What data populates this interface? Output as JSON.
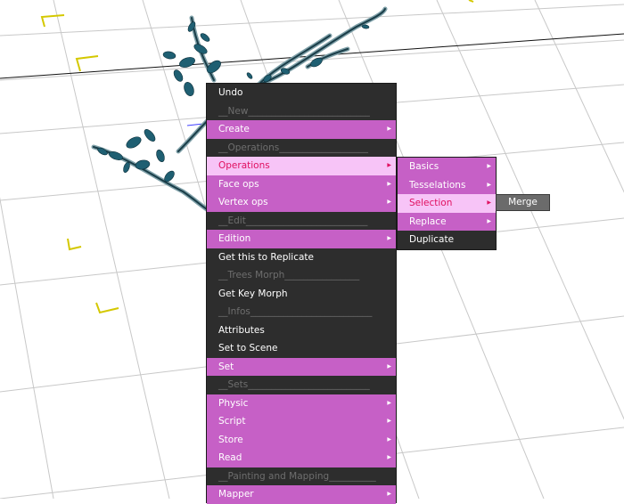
{
  "main_menu": {
    "items": [
      {
        "label": "Undo",
        "style": "dark",
        "arrow": false,
        "name": "menu-item-undo",
        "interactable": true
      },
      {
        "label": "__New__________________________",
        "style": "sep",
        "arrow": false,
        "name": "menu-separator-new",
        "interactable": false
      },
      {
        "label": "Create",
        "style": "pink",
        "arrow": true,
        "name": "menu-item-create",
        "interactable": true
      },
      {
        "label": "__Operations___________________",
        "style": "sep",
        "arrow": false,
        "name": "menu-separator-operations",
        "interactable": false
      },
      {
        "label": "Operations",
        "style": "light",
        "arrow": true,
        "name": "menu-item-operations",
        "interactable": true
      },
      {
        "label": "Face ops",
        "style": "pink",
        "arrow": true,
        "name": "menu-item-face-ops",
        "interactable": true
      },
      {
        "label": "Vertex ops",
        "style": "pink",
        "arrow": true,
        "name": "menu-item-vertex-ops",
        "interactable": true
      },
      {
        "label": "__Edit__________________________",
        "style": "sep",
        "arrow": false,
        "name": "menu-separator-edit",
        "interactable": false
      },
      {
        "label": "Edition",
        "style": "pink",
        "arrow": true,
        "name": "menu-item-edition",
        "interactable": true
      },
      {
        "label": "Get this to Replicate",
        "style": "dark",
        "arrow": false,
        "name": "menu-item-get-this-to-replicate",
        "interactable": true
      },
      {
        "label": "__Trees Morph________________",
        "style": "sep",
        "arrow": false,
        "name": "menu-separator-trees-morph",
        "interactable": false
      },
      {
        "label": "Get Key Morph",
        "style": "dark",
        "arrow": false,
        "name": "menu-item-get-key-morph",
        "interactable": true
      },
      {
        "label": "__Infos__________________________",
        "style": "sep",
        "arrow": false,
        "name": "menu-separator-infos",
        "interactable": false
      },
      {
        "label": "Attributes",
        "style": "dark",
        "arrow": false,
        "name": "menu-item-attributes",
        "interactable": true
      },
      {
        "label": "Set to Scene",
        "style": "dark",
        "arrow": false,
        "name": "menu-item-set-to-scene",
        "interactable": true
      },
      {
        "label": "Set",
        "style": "pink",
        "arrow": true,
        "name": "menu-item-set",
        "interactable": true
      },
      {
        "label": "__Sets__________________________",
        "style": "sep",
        "arrow": false,
        "name": "menu-separator-sets",
        "interactable": false
      },
      {
        "label": "Physic",
        "style": "pink",
        "arrow": true,
        "name": "menu-item-physic",
        "interactable": true
      },
      {
        "label": "Script",
        "style": "pink",
        "arrow": true,
        "name": "menu-item-script",
        "interactable": true
      },
      {
        "label": "Store",
        "style": "pink",
        "arrow": true,
        "name": "menu-item-store",
        "interactable": true
      },
      {
        "label": "Read",
        "style": "pink",
        "arrow": true,
        "name": "menu-item-read",
        "interactable": true
      },
      {
        "label": "__Painting and Mapping__________",
        "style": "sep",
        "arrow": false,
        "name": "menu-separator-painting-mapping",
        "interactable": false
      },
      {
        "label": "Mapper",
        "style": "pink",
        "arrow": true,
        "name": "menu-item-mapper",
        "interactable": true
      }
    ]
  },
  "operations_submenu": {
    "items": [
      {
        "label": "Basics",
        "style": "pink",
        "arrow": true,
        "name": "submenu-item-basics",
        "interactable": true
      },
      {
        "label": "Tesselations",
        "style": "pink",
        "arrow": true,
        "name": "submenu-item-tesselations",
        "interactable": true
      },
      {
        "label": "Selection",
        "style": "light",
        "arrow": true,
        "name": "submenu-item-selection",
        "interactable": true
      },
      {
        "label": "Replace",
        "style": "pink",
        "arrow": true,
        "name": "submenu-item-replace",
        "interactable": true
      },
      {
        "label": "Duplicate",
        "style": "dark",
        "arrow": false,
        "name": "submenu-item-duplicate",
        "interactable": true
      }
    ]
  },
  "selection_submenu": {
    "merge_label": "Merge"
  },
  "colors": {
    "menu_bg": "#2d2d2d",
    "item_pink": "#c660c6",
    "item_highlight": "#f7c4f7",
    "highlight_text": "#e01060",
    "separator_text": "#6e6e6e",
    "grid_line": "#c8c8c8",
    "marker_yellow": "#d4c800",
    "foliage": "#1f5f72"
  }
}
